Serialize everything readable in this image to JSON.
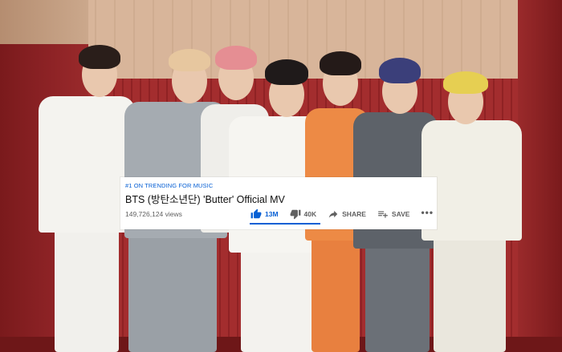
{
  "video": {
    "trending_label": "#1 ON TRENDING FOR MUSIC",
    "title": "BTS (방탄소년단) 'Butter' Official MV",
    "views": "149,726,124 views",
    "actions": {
      "like_count": "13M",
      "dislike_count": "40K",
      "share_label": "SHARE",
      "save_label": "SAVE",
      "more_label": "•••"
    },
    "like_ratio": 0.997
  },
  "colors": {
    "accent": "#065fd4",
    "text_primary": "#0f0f0f",
    "text_secondary": "#606060",
    "background_red": "#9a2a2b"
  },
  "icons": [
    "thumbs-up-icon",
    "thumbs-down-icon",
    "share-icon",
    "save-playlist-icon",
    "more-icon"
  ]
}
